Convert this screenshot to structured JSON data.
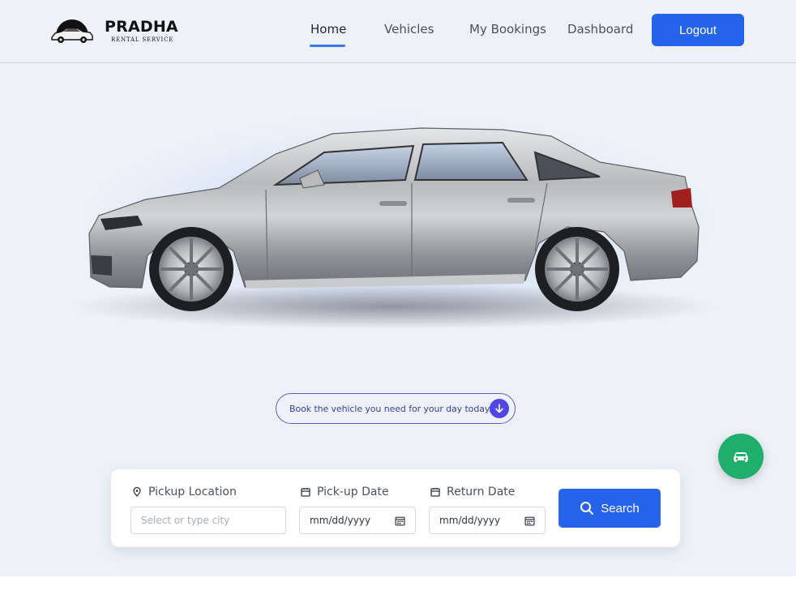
{
  "brand": {
    "name": "PRADHA",
    "tagline": "RENTAL SERVICE"
  },
  "nav": {
    "items": [
      {
        "label": "Home",
        "active": true
      },
      {
        "label": "Vehicles",
        "active": false
      },
      {
        "label": "My Bookings",
        "active": false
      },
      {
        "label": "Dashboard",
        "active": false
      }
    ],
    "logout_label": "Logout"
  },
  "hero": {
    "tagline": "Book the vehicle you need for your day today."
  },
  "search": {
    "pickup_location": {
      "label": "Pickup Location",
      "placeholder": "Select or type city"
    },
    "pickup_date": {
      "label": "Pick-up Date",
      "value": "mm/dd/yyyy"
    },
    "return_date": {
      "label": "Return Date",
      "value": "mm/dd/yyyy"
    },
    "button_label": "Search"
  },
  "icons": {
    "location": "map-pin-icon",
    "calendar": "calendar-icon",
    "search": "search-icon",
    "arrow": "arrow-down-icon",
    "car": "car-icon"
  },
  "colors": {
    "primary": "#2563eb",
    "accent": "#4f46e5",
    "fab": "#1fae6b",
    "background": "#eef2f8"
  }
}
